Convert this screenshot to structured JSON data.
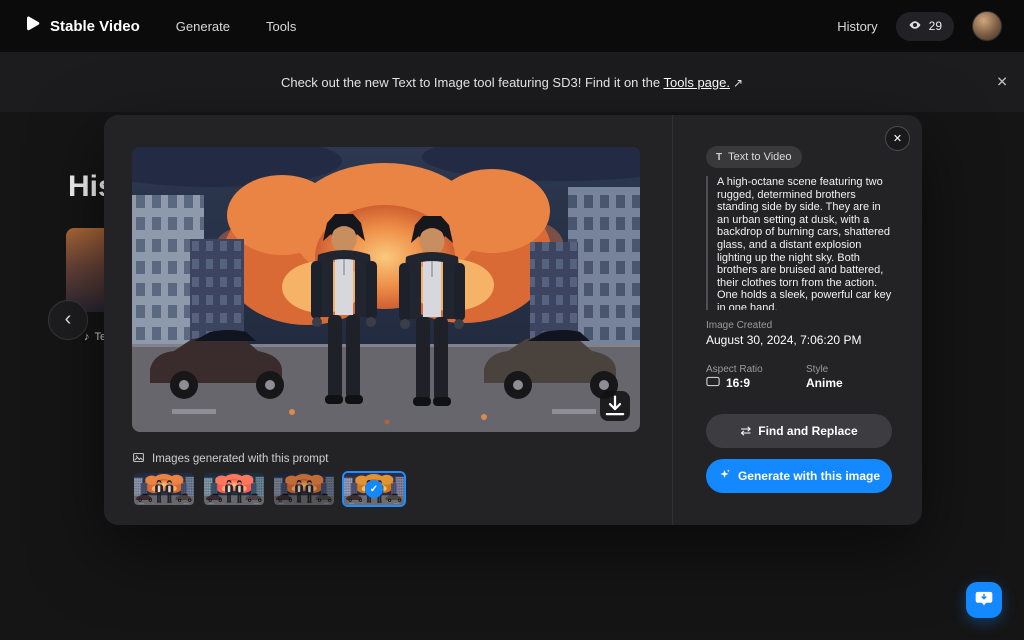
{
  "navbar": {
    "brand": "Stable Video",
    "items": [
      {
        "label": "Generate"
      },
      {
        "label": "Tools"
      }
    ],
    "history_label": "History",
    "credits": "29"
  },
  "banner": {
    "text": "Check out the new Text to Image tool featuring SD3! Find it on the ",
    "link_label": "Tools page.",
    "arrow": "↗"
  },
  "history": {
    "title": "History",
    "partial_card_label": "Te"
  },
  "modal": {
    "caption": "Images generated with this prompt",
    "badge": "Text to Video",
    "prompt": "A high-octane scene featuring two rugged, determined brothers standing side by side. They are in an urban setting at dusk, with a backdrop of burning cars, shattered glass, and a distant explosion lighting up the night sky. Both brothers are bruised and battered, their clothes torn from the action. One holds a sleek, powerful car key in one hand,",
    "image_created_label": "Image Created",
    "image_created_value": "August 30, 2024, 7:06:20 PM",
    "aspect_ratio_label": "Aspect Ratio",
    "aspect_ratio_value": "16:9",
    "style_label": "Style",
    "style_value": "Anime",
    "find_replace_label": "Find and Replace",
    "generate_label": "Generate with this image",
    "thumbnails_count": 4,
    "selected_thumbnail": 4
  },
  "icons": {
    "close": "✕",
    "chevron_left": "‹",
    "check": "✓",
    "music_note": "♪",
    "swap": "⇄",
    "text_badge": "T"
  },
  "colors": {
    "accent_blue": "#1488FF",
    "navbar_bg": "#0B0B0C",
    "banner_bg": "#1C1C1E",
    "page_bg": "#151515",
    "modal_bg": "#232326",
    "selected_border": "#1E8FFF"
  }
}
